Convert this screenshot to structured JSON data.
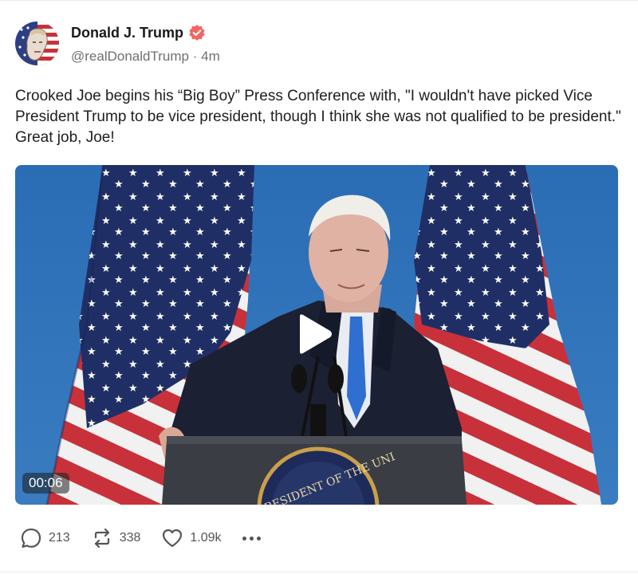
{
  "author": {
    "display_name": "Donald J. Trump",
    "handle": "@realDonaldTrump",
    "separator": "·",
    "time_ago": "4m",
    "verified": true
  },
  "post": {
    "text": "Crooked Joe begins his “Big Boy” Press Conference with, \"I wouldn't have picked Vice President Trump to be vice president, though I think she was not qualified to be president.\" Great job, Joe!"
  },
  "video": {
    "duration": "00:06",
    "seal_text": "RESIDENT OF THE UNI"
  },
  "actions": {
    "replies": "213",
    "retruths": "338",
    "likes": "1.09k"
  },
  "colors": {
    "verified_badge": "#f26563",
    "backdrop_blue": "#2f6fb3",
    "flag_blue": "#1f2f66",
    "flag_red": "#c8313a",
    "text_muted": "#707070"
  },
  "icons": [
    "verified-badge-icon",
    "play-icon",
    "reply-icon",
    "retruth-icon",
    "heart-icon",
    "more-icon"
  ]
}
